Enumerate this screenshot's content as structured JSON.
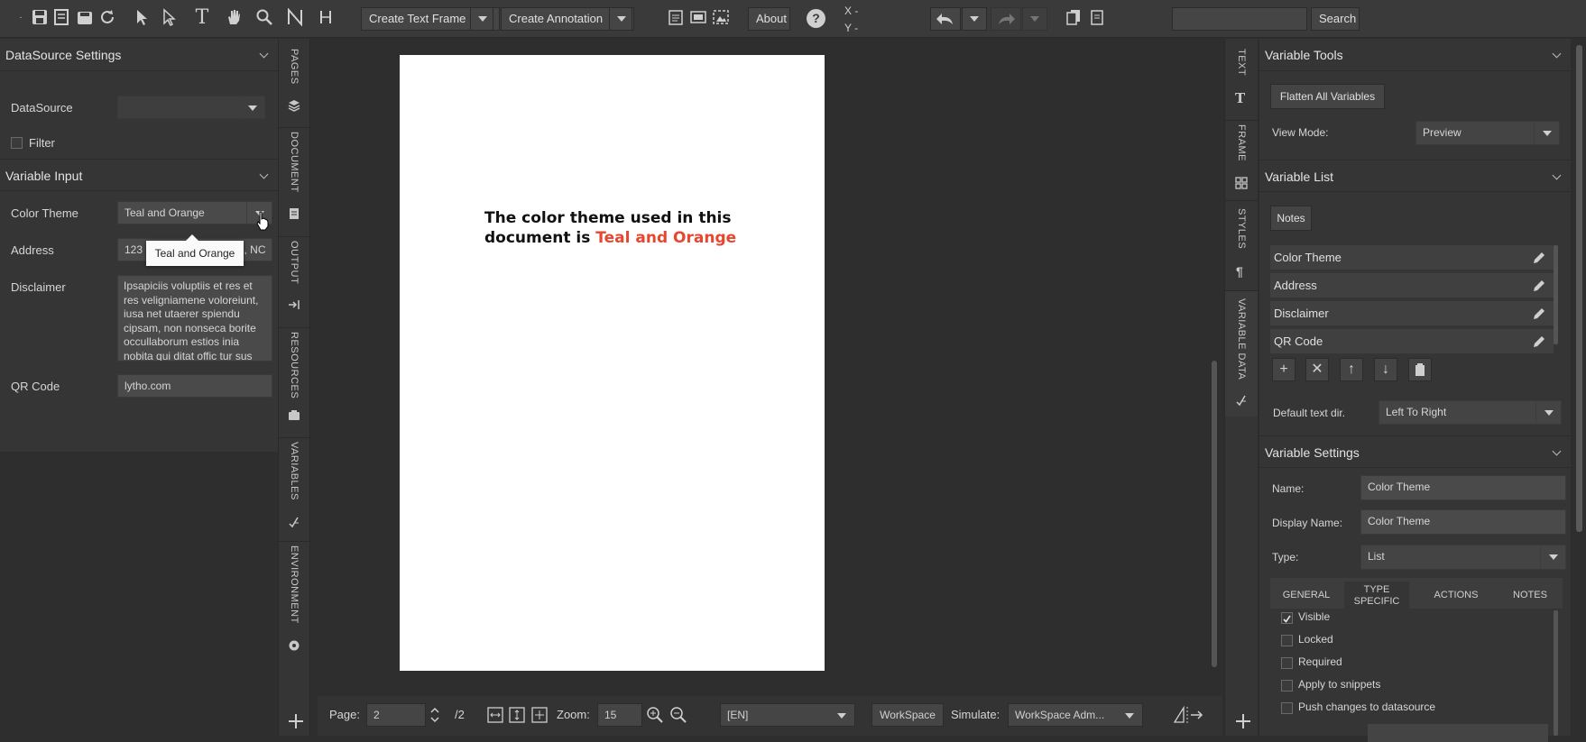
{
  "toolbar": {
    "create_text_frame": "Create Text Frame",
    "create_annotation": "Create Annotation",
    "about": "About",
    "help_glyph": "?",
    "x_label": "X -",
    "y_label": "Y -",
    "search_placeholder": "",
    "search_button": "Search"
  },
  "left": {
    "datasource_settings": "DataSource Settings",
    "datasource_label": "DataSource",
    "datasource_value": "",
    "filter_label": "Filter",
    "variable_input": "Variable Input",
    "color_theme_label": "Color Theme",
    "color_theme_value": "Teal and Orange",
    "tooltip": "Teal and Orange",
    "address_label": "Address",
    "address_value": "123 Main St, Smith Town, NC",
    "disclaimer_label": "Disclaimer",
    "disclaimer_value": "Ipsapiciis voluptiis et res et res veligniamene voloreiunt, iusa net utaerer spiendu cipsam, non nonseca borite occullaborum estios inia nobita qui ditat offic tur sus dolorem ulla",
    "qr_label": "QR Code",
    "qr_value": "lytho.com"
  },
  "vtabs": {
    "pages": "PAGES",
    "document": "DOCUMENT",
    "output": "OUTPUT",
    "resources": "RESOURCES",
    "variables": "VARIABLES",
    "environment": "ENVIRONMENT"
  },
  "canvas": {
    "line1": "The color theme used in this",
    "line2_prefix": "document is ",
    "line2_value": "Teal and Orange",
    "accent": "#e8472f"
  },
  "rvtabs": {
    "text": "TEXT",
    "frame": "FRAME",
    "styles": "STYLES",
    "variable_data": "VARIABLE DATA"
  },
  "right": {
    "variable_tools": "Variable Tools",
    "flatten": "Flatten All Variables",
    "view_mode_label": "View Mode:",
    "view_mode_value": "Preview",
    "variable_list": "Variable List",
    "notes": "Notes",
    "items": [
      "Color Theme",
      "Address",
      "Disclaimer",
      "QR Code"
    ],
    "default_dir_label": "Default text dir.",
    "default_dir_value": "Left To Right",
    "variable_settings": "Variable Settings",
    "name_label": "Name:",
    "name_value": "Color Theme",
    "display_label": "Display Name:",
    "display_value": "Color Theme",
    "type_label": "Type:",
    "type_value": "List",
    "tabs": [
      "GENERAL",
      "TYPE SPECIFIC",
      "ACTIONS",
      "NOTES"
    ],
    "checks": [
      {
        "label": "Visible",
        "checked": true
      },
      {
        "label": "Locked",
        "checked": false
      },
      {
        "label": "Required",
        "checked": false
      },
      {
        "label": "Apply to snippets",
        "checked": false
      },
      {
        "label": "Push changes to datasource",
        "checked": false
      }
    ]
  },
  "bottom": {
    "page_label": "Page:",
    "page_value": "2",
    "page_total": "/2",
    "zoom_label": "Zoom:",
    "zoom_value": "15",
    "language": "[EN]",
    "workspace": "WorkSpace",
    "simulate_label": "Simulate:",
    "simulate_value": "WorkSpace Adm..."
  }
}
